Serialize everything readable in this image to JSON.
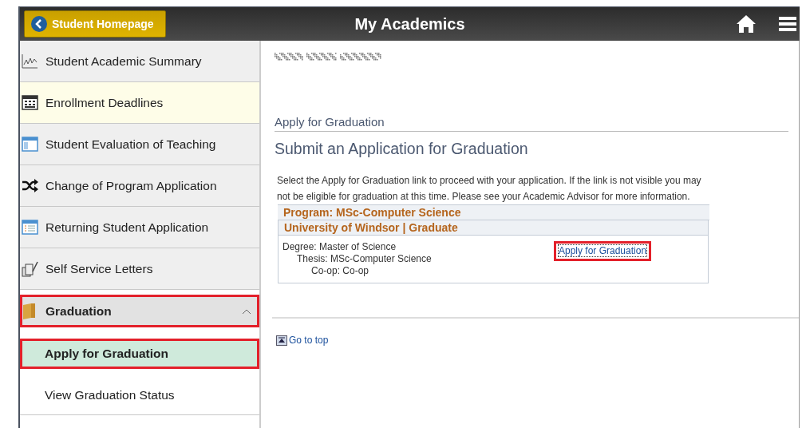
{
  "header": {
    "back_button": "Student Homepage",
    "title": "My Academics"
  },
  "sidebar": {
    "items": [
      {
        "kind": "link",
        "label": "Student Academic Summary",
        "hovered": false
      },
      {
        "kind": "link",
        "label": "Enrollment Deadlines",
        "hovered": true
      },
      {
        "kind": "link",
        "label": "Student Evaluation of Teaching",
        "hovered": false
      },
      {
        "kind": "link",
        "label": "Change of Program Application",
        "hovered": false
      },
      {
        "kind": "link",
        "label": "Returning Student Application",
        "hovered": false
      },
      {
        "kind": "link",
        "label": "Self Service Letters",
        "hovered": false
      },
      {
        "kind": "group",
        "label": "Graduation",
        "expanded": true,
        "highlighted": true
      },
      {
        "kind": "subitem",
        "label": "Apply for Graduation",
        "selected": true,
        "highlighted": true
      },
      {
        "kind": "subitem",
        "label": "View Graduation Status",
        "selected": false,
        "highlighted": false
      }
    ]
  },
  "content": {
    "section_title": "Apply for Graduation",
    "page_title": "Submit an Application for Graduation",
    "instructions": "Select the Apply for Graduation link to proceed with your application. If the link is not visible you may not be eligible for graduation at this time. Please see your Academic Advisor for more information.",
    "program": {
      "heading": "Program: MSc-Computer Science",
      "career": "University of Windsor | Graduate",
      "details": [
        "Degree: Master of Science",
        "Thesis: MSc-Computer Science",
        "Co-op: Co-op"
      ],
      "apply_link": {
        "label": "Apply for Graduation",
        "highlighted": true
      }
    },
    "go_to_top": "Go to top"
  }
}
